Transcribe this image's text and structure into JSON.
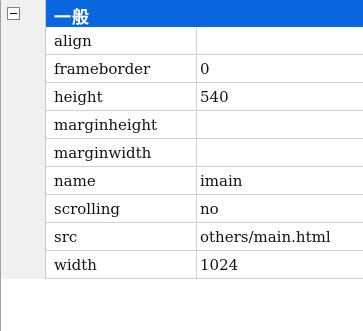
{
  "category": {
    "label": "一般",
    "expanded": true,
    "header_color": "#0a66de"
  },
  "properties": [
    {
      "name": "align",
      "value": ""
    },
    {
      "name": "frameborder",
      "value": "0"
    },
    {
      "name": "height",
      "value": "540"
    },
    {
      "name": "marginheight",
      "value": ""
    },
    {
      "name": "marginwidth",
      "value": ""
    },
    {
      "name": "name",
      "value": "imain"
    },
    {
      "name": "scrolling",
      "value": "no"
    },
    {
      "name": "src",
      "value": "others/main.html"
    },
    {
      "name": "width",
      "value": "1024"
    }
  ]
}
